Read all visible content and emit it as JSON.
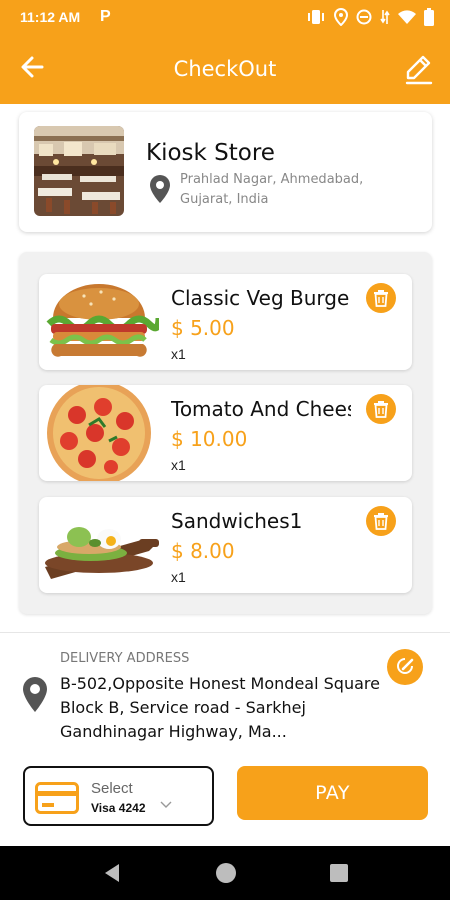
{
  "status_bar": {
    "time": "11:12 AM",
    "notification": "P"
  },
  "header": {
    "title": "CheckOut"
  },
  "store": {
    "name": "Kiosk Store",
    "address": "Prahlad Nagar, Ahmedabad, Gujarat, India"
  },
  "cart": {
    "items": [
      {
        "name": "Classic Veg Burger",
        "price": "$ 5.00",
        "qty": "x1",
        "image": "burger"
      },
      {
        "name": "Tomato And Cheese",
        "price": "$ 10.00",
        "qty": "x1",
        "image": "pizza"
      },
      {
        "name": "Sandwiches1",
        "price": "$ 8.00",
        "qty": "x1",
        "image": "sandwich"
      }
    ]
  },
  "delivery": {
    "label": "DELIVERY ADDRESS",
    "address": "B-502,Opposite Honest Mondeal Square Block B, Service road - Sarkhej Gandhinagar Highway, Ma..."
  },
  "payment": {
    "select_label": "Select",
    "selected_card": "Visa 4242",
    "pay_label": "PAY"
  },
  "colors": {
    "accent": "#F7A11A",
    "text": "#111111",
    "muted": "#888888"
  }
}
